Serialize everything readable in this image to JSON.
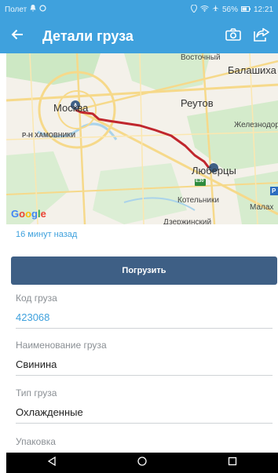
{
  "statusbar": {
    "left_text": "Полет",
    "battery": "56%",
    "time": "12:21"
  },
  "appbar": {
    "title": "Детали груза",
    "icons": [
      "back-arrow-icon",
      "camera-icon",
      "share-icon"
    ]
  },
  "map": {
    "labels": {
      "vostochny": "Восточный",
      "balashikha": "Балашиха",
      "moskva": "Москва",
      "reutov": "Реутов",
      "khamovniki": "Р-Н ХАМОВНИКИ",
      "zheleznodor": "Железнодор",
      "lyubertsy": "Люберцы",
      "kotelniki": "Котельники",
      "malakh": "Малах",
      "dzerzhinsky": "Дзержинский",
      "e30": "E30",
      "p": "P"
    },
    "attribution": "Google",
    "route_color": "#c0262d"
  },
  "timestamp": "16 минут назад",
  "load_button": "Погрузить",
  "fields": {
    "code": {
      "label": "Код груза",
      "value": "423068"
    },
    "name": {
      "label": "Наименование груза",
      "value": "Свинина"
    },
    "type": {
      "label": "Тип груза",
      "value": "Охлажденные"
    },
    "packaging": {
      "label": "Упаковка",
      "value": ""
    }
  },
  "navbar": {
    "icons": [
      "back-triangle-icon",
      "home-circle-icon",
      "recents-square-icon"
    ]
  },
  "colors": {
    "accent": "#3fa1dd",
    "button": "#3e5f85"
  }
}
